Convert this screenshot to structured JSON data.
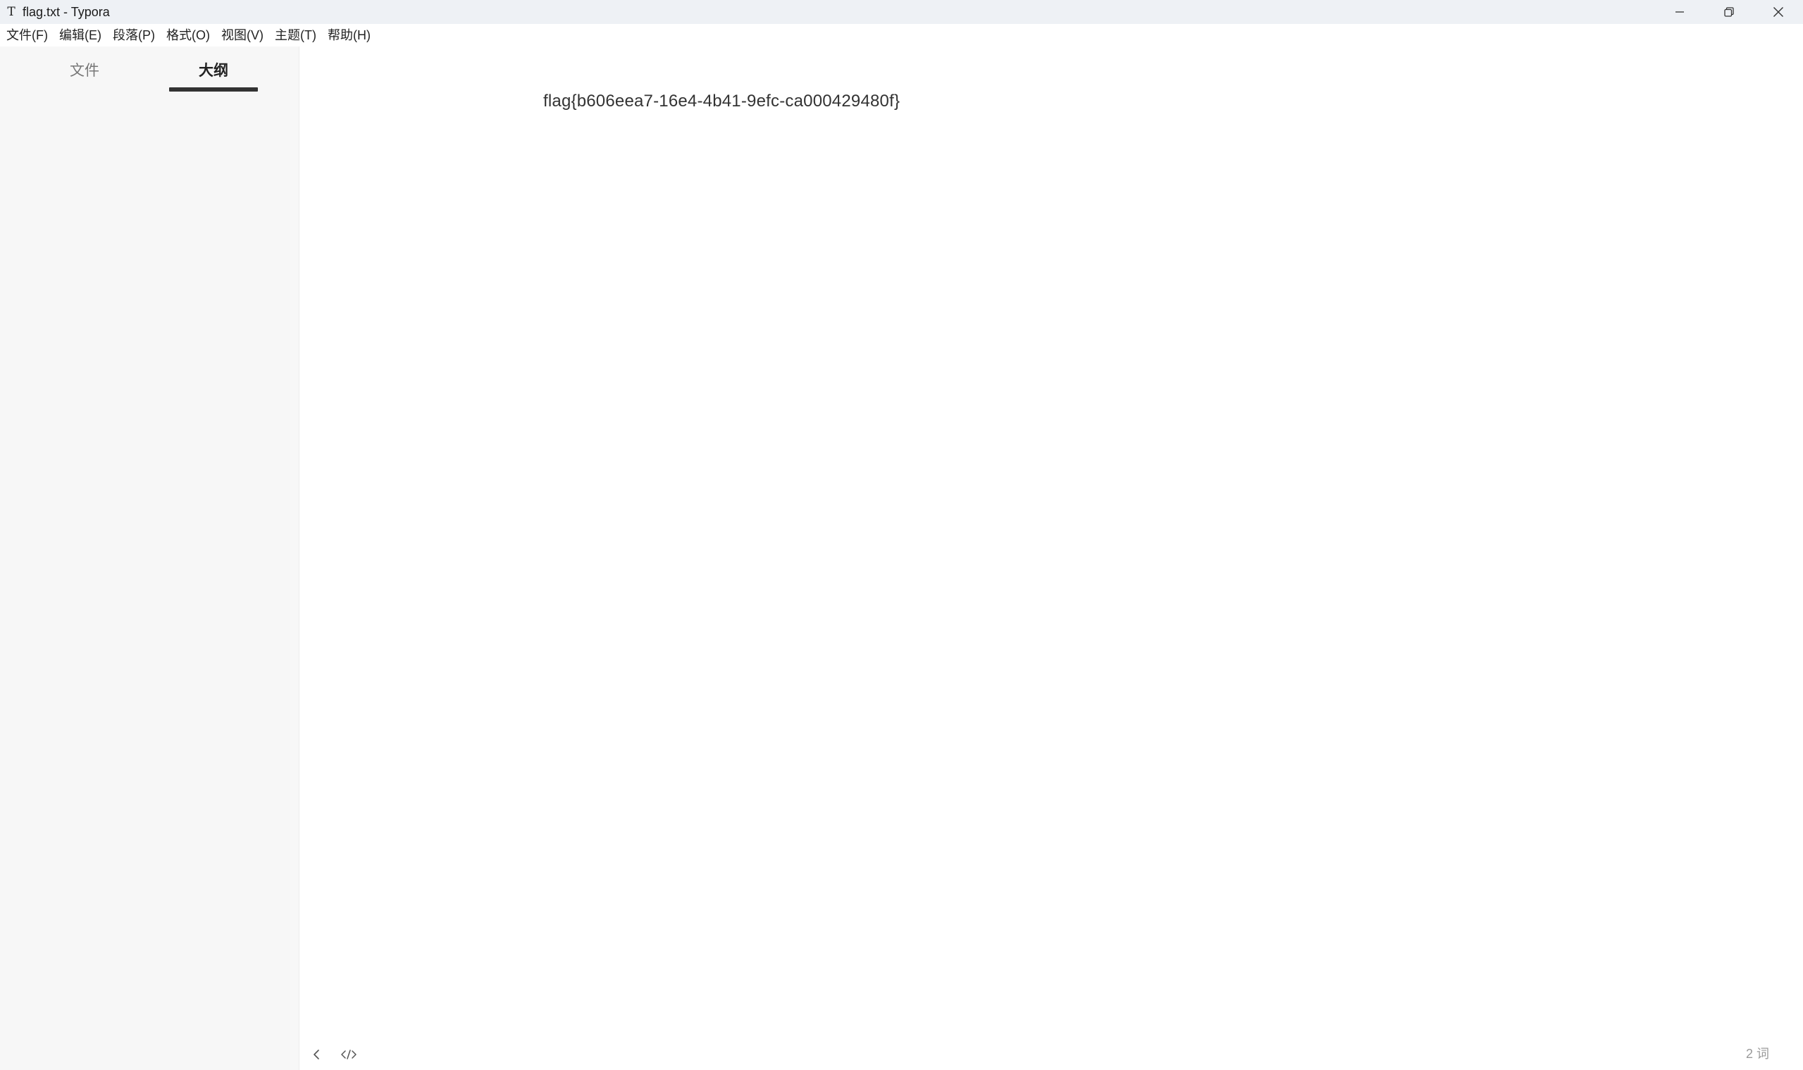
{
  "window": {
    "icon_glyph": "T",
    "title": "flag.txt - Typora",
    "controls": {
      "minimize": "minimize-icon",
      "restore": "restore-icon",
      "close": "close-icon"
    }
  },
  "menubar": {
    "items": [
      {
        "label": "文件(F)"
      },
      {
        "label": "编辑(E)"
      },
      {
        "label": "段落(P)"
      },
      {
        "label": "格式(O)"
      },
      {
        "label": "视图(V)"
      },
      {
        "label": "主题(T)"
      },
      {
        "label": "帮助(H)"
      }
    ]
  },
  "sidebar": {
    "tabs": [
      {
        "label": "文件",
        "active": false
      },
      {
        "label": "大纲",
        "active": true
      }
    ]
  },
  "editor": {
    "content": "flag{b606eea7-16e4-4b41-9efc-ca000429480f}"
  },
  "footer": {
    "toggle_sidebar_icon": "chevron-left-icon",
    "source_mode_icon": "code-icon",
    "word_count": "2 词"
  }
}
